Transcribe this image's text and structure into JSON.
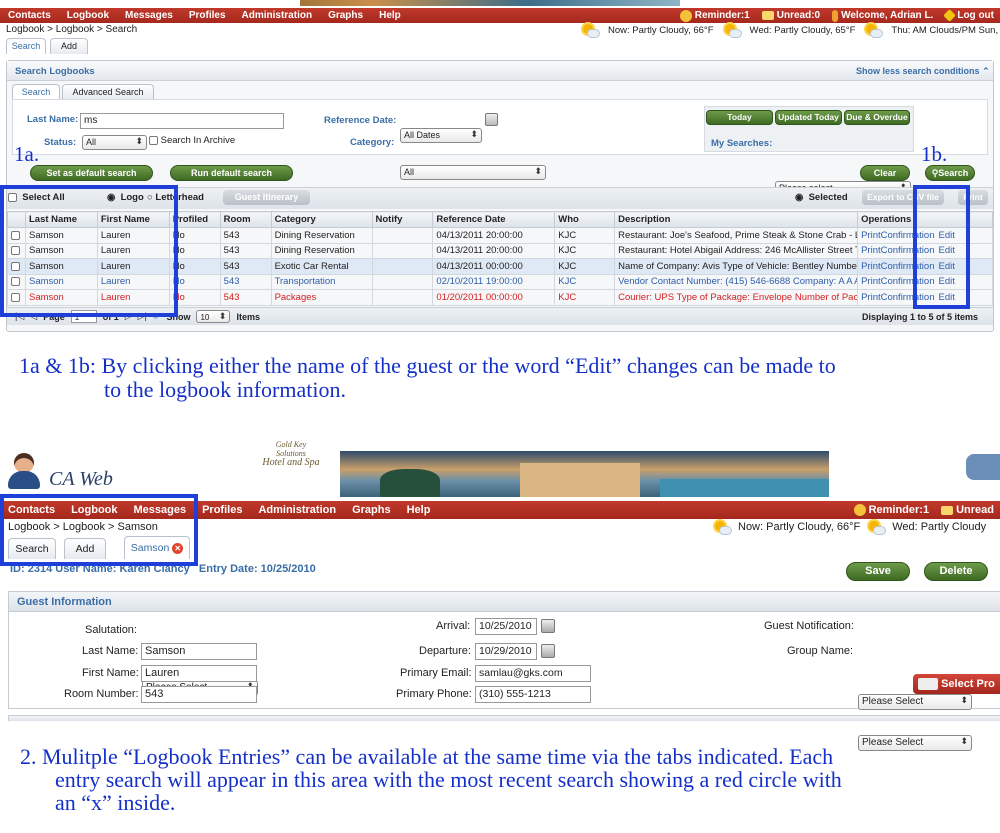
{
  "top": {
    "nav": [
      "Contacts",
      "Logbook",
      "Messages",
      "Profiles",
      "Administration",
      "Graphs",
      "Help"
    ],
    "reminder": "Reminder:1",
    "unread": "Unread:0",
    "welcome": "Welcome, Adrian L.",
    "logout": "Log out",
    "breadcrumb": "Logbook > Logbook > Search",
    "weather_now": "Now: Partly Cloudy, 66°F",
    "weather_wed": "Wed: Partly Cloudy, 65°F",
    "weather_thu": "Thu: AM Clouds/PM Sun, 60°F",
    "tabs": [
      "Search",
      "Add"
    ],
    "panel_title": "Search Logbooks",
    "show_less": "Show less search conditions",
    "subtabs": [
      "Search",
      "Advanced Search"
    ],
    "last_name_label": "Last Name:",
    "last_name_value": "ms",
    "status_label": "Status:",
    "status_value": "All",
    "search_archive": "Search In Archive",
    "ref_date_label": "Reference Date:",
    "ref_date_value": "All Dates",
    "category_label": "Category:",
    "category_value": "All",
    "btn_today": "Today",
    "btn_updated": "Updated Today",
    "btn_due": "Due & Overdue",
    "my_searches_label": "My Searches:",
    "my_searches_value": "Please select",
    "btn_default": "Set as default search",
    "btn_run_default": "Run default search",
    "btn_clear": "Clear",
    "btn_search": "Search",
    "select_all": "Select All",
    "logo": "Logo",
    "letterhead": "Letterhead",
    "guest_itinerary": "Guest Itinerary",
    "selected": "Selected",
    "export_csv": "Export to CSV file",
    "print": "Print",
    "columns": [
      "Last Name",
      "First Name",
      "Profiled",
      "Room",
      "Category",
      "Notify",
      "Reference Date",
      "Who",
      "Description",
      "Operations"
    ],
    "rows": [
      {
        "last": "Samson",
        "first": "Lauren",
        "profiled": "No",
        "room": "543",
        "category": "Dining Reservation",
        "notify": "",
        "date": "04/13/2011 20:00:00",
        "who": "KJC",
        "desc": "Restaurant: Joe's Seafood, Prime Steak & Stone Crab - Las…",
        "ops": "PrintConfirmation",
        "edit": "Edit",
        "style": ""
      },
      {
        "last": "Samson",
        "first": "Lauren",
        "profiled": "No",
        "room": "543",
        "category": "Dining Reservation",
        "notify": "",
        "date": "04/13/2011 20:00:00",
        "who": "KJC",
        "desc": "Restaurant: Hotel Abigail Address: 246 McAllister Street Te…",
        "ops": "PrintConfirmation",
        "edit": "Edit",
        "style": ""
      },
      {
        "last": "Samson",
        "first": "Lauren",
        "profiled": "No",
        "room": "543",
        "category": "Exotic Car Rental",
        "notify": "",
        "date": "04/13/2011 00:00:00",
        "who": "KJC",
        "desc": "Name of Company: Avis Type of Vehicle: Bentley Number …",
        "ops": "PrintConfirmation",
        "edit": "Edit",
        "style": "sel-row"
      },
      {
        "last": "Samson",
        "first": "Lauren",
        "profiled": "No",
        "room": "543",
        "category": "Transportation",
        "notify": "",
        "date": "02/10/2011 19:00:00",
        "who": "KJC",
        "desc": "Vendor Contact Number: (415) 546-6688 Company: A A A …",
        "ops": "PrintConfirmation",
        "edit": "Edit",
        "style": "blue"
      },
      {
        "last": "Samson",
        "first": "Lauren",
        "profiled": "No",
        "room": "543",
        "category": "Packages",
        "notify": "",
        "date": "01/20/2011 00:00:00",
        "who": "KJC",
        "desc": "Courier: UPS Type of Package: Envelope Number of Packa…",
        "ops": "PrintConfirmation",
        "edit": "Edit",
        "style": "red"
      }
    ],
    "page_label": "Page",
    "page_value": "1",
    "page_of": "of 1",
    "show_label": "Show",
    "show_value": "10",
    "items_label": "Items",
    "displaying": "Displaying 1 to 5 of 5 items"
  },
  "annot": {
    "label_1a": "1a.",
    "label_1b": "1b.",
    "text_1_line1": "1a & 1b: By clicking either the name of the guest or the word “Edit” changes can be made to",
    "text_1_line2": "to the logbook information.",
    "text_2_line1": "2.  Mulitple “Logbook Entries” can be available at the same time via the tabs indicated.  Each",
    "text_2_line2": "entry search will appear in this area with the most recent search showing a red circle with",
    "text_2_line3": "an “x” inside."
  },
  "bottom": {
    "app_name": "CA Web",
    "hotel_line1": "Gold Key",
    "hotel_line2": "Solutions",
    "hotel_line3": "Hotel and Spa",
    "nav": [
      "Contacts",
      "Logbook",
      "Messages",
      "Profiles",
      "Administration",
      "Graphs",
      "Help"
    ],
    "reminder": "Reminder:1",
    "unread": "Unread",
    "breadcrumb": "Logbook > Logbook > Samson",
    "weather_now": "Now: Partly Cloudy, 66°F",
    "weather_wed": "Wed: Partly Cloudy",
    "tabs": [
      "Search",
      "Add",
      "Samson"
    ],
    "id_line": "ID:  2314     User Name:  Karen Clancy",
    "entry_date": "Entry Date:  10/25/2010",
    "btn_save": "Save",
    "btn_delete": "Delete",
    "section_title": "Guest Information",
    "salutation_label": "Salutation:",
    "salutation_value": "Please Select",
    "last_name_label": "Last Name:",
    "last_name_value": "Samson",
    "first_name_label": "First Name:",
    "first_name_value": "Lauren",
    "room_label": "Room Number:",
    "room_value": "543",
    "arrival_label": "Arrival:",
    "arrival_value": "10/25/2010",
    "departure_label": "Departure:",
    "departure_value": "10/29/2010",
    "email_label": "Primary Email:",
    "email_value": "samlau@gks.com",
    "phone_label": "Primary Phone:",
    "phone_value": "(310) 555-1213",
    "notif_label": "Guest Notification:",
    "notif_value": "Please Select",
    "group_label": "Group Name:",
    "group_value": "Please Select",
    "select_profile": "Select Pro"
  }
}
